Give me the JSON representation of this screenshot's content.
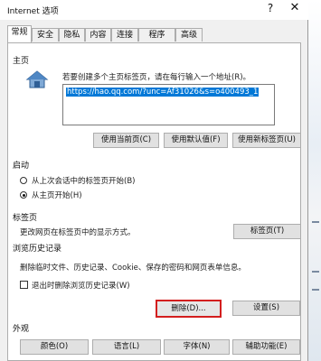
{
  "window": {
    "title": "Internet 选项",
    "help_glyph": "?",
    "close_glyph": "✕"
  },
  "tabs": [
    "常规",
    "安全",
    "隐私",
    "内容",
    "连接",
    "程序",
    "高级"
  ],
  "active_tab": "常规",
  "homepage": {
    "label": "主页",
    "instruction": "若要创建多个主页标签页，请在每行输入一个地址(R)。",
    "url": "https://hao.qq.com/?unc=Af31026&s=o400493_1",
    "buttons": [
      "使用当前页(C)",
      "使用默认值(F)",
      "使用新标签页(U)"
    ]
  },
  "startup": {
    "label": "启动",
    "options": [
      {
        "label": "从上次会话中的标签页开始(B)",
        "checked": false
      },
      {
        "label": "从主页开始(H)",
        "checked": true
      }
    ]
  },
  "tabs_section": {
    "label": "标签页",
    "description": "更改网页在标签页中的显示方式。",
    "button": "标签页(T)"
  },
  "history": {
    "label": "浏览历史记录",
    "description": "删除临时文件、历史记录、Cookie、保存的密码和网页表单信息。",
    "checkbox_label": "退出时删除浏览历史记录(W)",
    "checkbox_checked": false,
    "delete_button": "删除(D)...",
    "settings_button": "设置(S)"
  },
  "appearance": {
    "label": "外观",
    "buttons": [
      "颜色(O)",
      "语言(L)",
      "字体(N)",
      "辅助功能(E)"
    ]
  },
  "colors": {
    "highlight_border": "#d31e1e",
    "selection": "#0078d7"
  }
}
